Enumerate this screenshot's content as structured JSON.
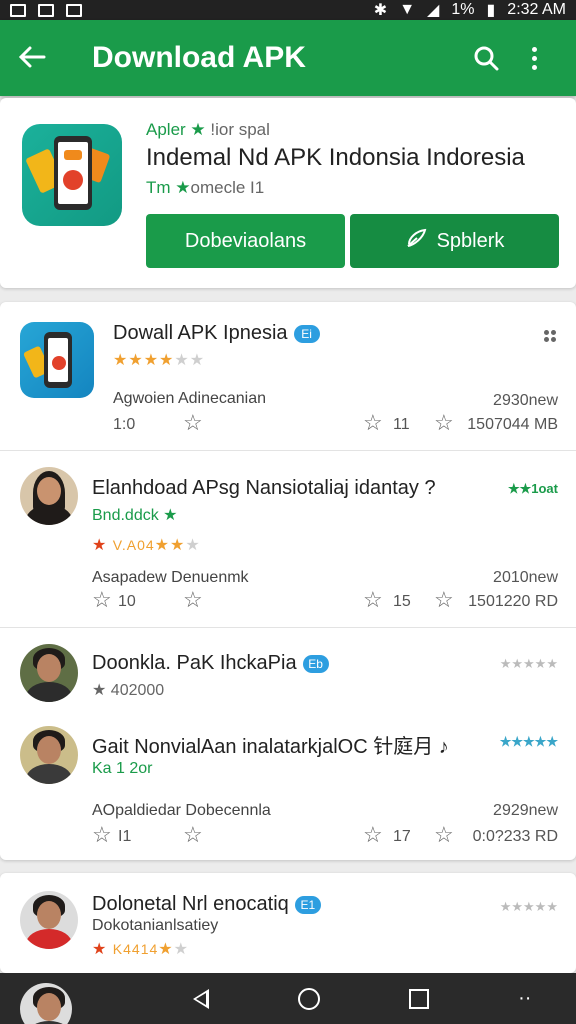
{
  "status": {
    "time": "2:32 AM",
    "battery": "1%"
  },
  "appbar": {
    "back_icon": "arrow-back-icon",
    "title": "Download APK",
    "search_icon": "search-icon",
    "menu_icon": "more-vert-icon"
  },
  "hero": {
    "category": "Apler ★",
    "category_gray": "!ior spal",
    "title": "Indemal Nd APK Indonsia Indoresia",
    "rating_text": "Tm ★",
    "rating_gray": "omecle I1",
    "download_label": "Dobeviaolans",
    "share_label": "Spblerk"
  },
  "list": [
    {
      "name": "Dowall APK Ipnesia",
      "badge": "Ei",
      "sub": "Agwoien Adinecanian",
      "meta_left": "1:0",
      "meta_count": "11",
      "meta_size": "1507044 MB",
      "meta_date": "2930new"
    },
    {
      "name": "Elanhdoad APsg Nansiotaliaj idantay ?",
      "sub_green": "Bnd.ddck ★",
      "stars_text": "V.A04",
      "sub": "Asapadew Denuenmk",
      "meta_left": "10",
      "meta_count": "15",
      "meta_size": "1501220 RD",
      "meta_date": "2010new",
      "corner": "★★1oat"
    },
    {
      "name": "Doonkla. PaK IhckaPia",
      "badge": "Eb",
      "sub": "★ 402000",
      "corner": "★★★★★"
    },
    {
      "name": "Gait NonvialAan inalatarkjalOC 针庭月 ♪",
      "sub_green": "Ka 1 2or",
      "corner": "★★★★★",
      "sub": "AOpaldiedar Dobecennla",
      "meta_left": "I1",
      "meta_count": "17",
      "meta_size": "0:0?233 RD",
      "meta_date": "2929new"
    },
    {
      "name": "Dolonetal Nrl enocatiq",
      "badge": "E1",
      "sub": "Dokotanianlsatiey",
      "stars_text": "K4414",
      "corner": "★★★★★"
    }
  ],
  "navbar": {
    "back": "nav-back-icon",
    "home": "nav-home-icon",
    "recents": "nav-recents-icon"
  }
}
